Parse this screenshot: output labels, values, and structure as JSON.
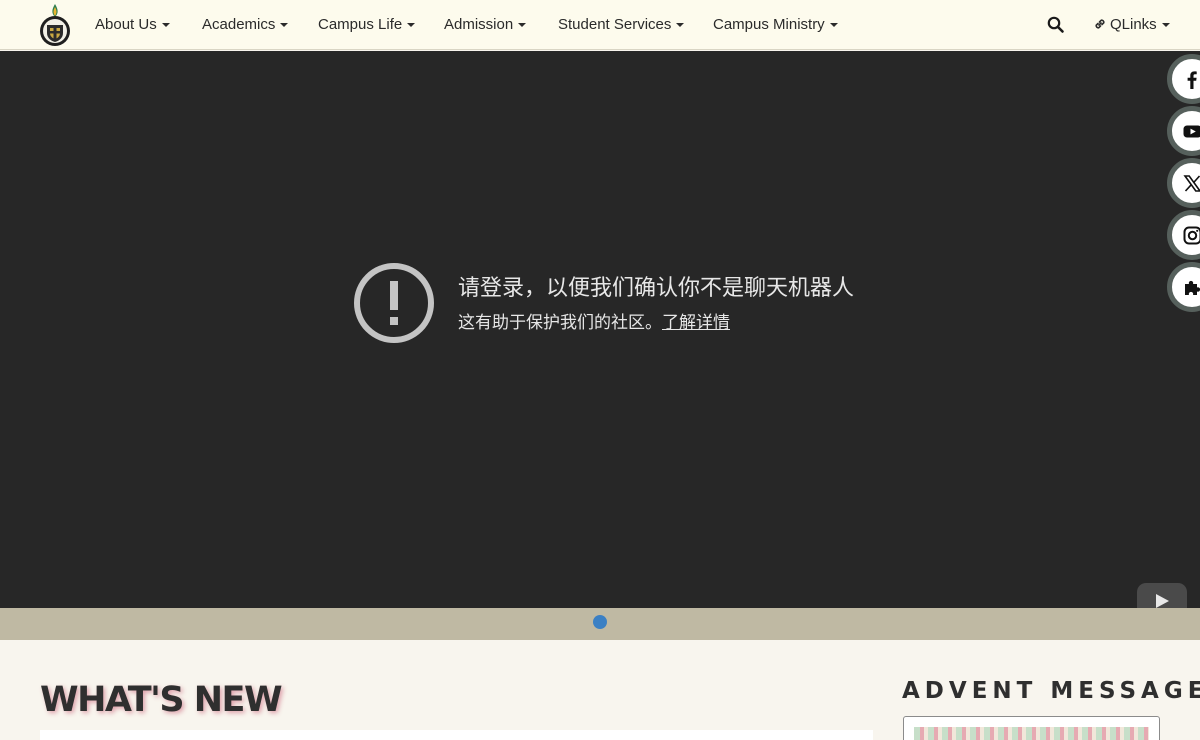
{
  "nav": {
    "items": [
      {
        "label": "About Us"
      },
      {
        "label": "Academics"
      },
      {
        "label": "Campus Life"
      },
      {
        "label": "Admission"
      },
      {
        "label": "Student Services"
      },
      {
        "label": "Campus Ministry"
      }
    ],
    "search_icon": "search-icon",
    "qlinks_label": "QLinks",
    "qlinks_icon": "link-icon"
  },
  "video": {
    "error_title": "请登录，以便我们确认你不是聊天机器人",
    "error_subtitle": "这有助于保护我们的社区。",
    "error_link": "了解详情",
    "play_icon": "youtube-play-icon"
  },
  "social": [
    "facebook-icon",
    "youtube-icon",
    "x-icon",
    "instagram-icon",
    "puzzle-icon"
  ],
  "carousel": {
    "active_slide": 1,
    "slide_count": 1
  },
  "sections": {
    "whats_new_title": "WHAT'S NEW",
    "advent_title": "ADVENT  MESSAGE"
  },
  "colors": {
    "nav_bg": "#fdfbed",
    "video_bg": "#272727",
    "carousel_bar": "#bfb9a3",
    "active_dot": "#3b80c4",
    "page_bg": "#f8f5ee",
    "social_border": "#56605c"
  }
}
